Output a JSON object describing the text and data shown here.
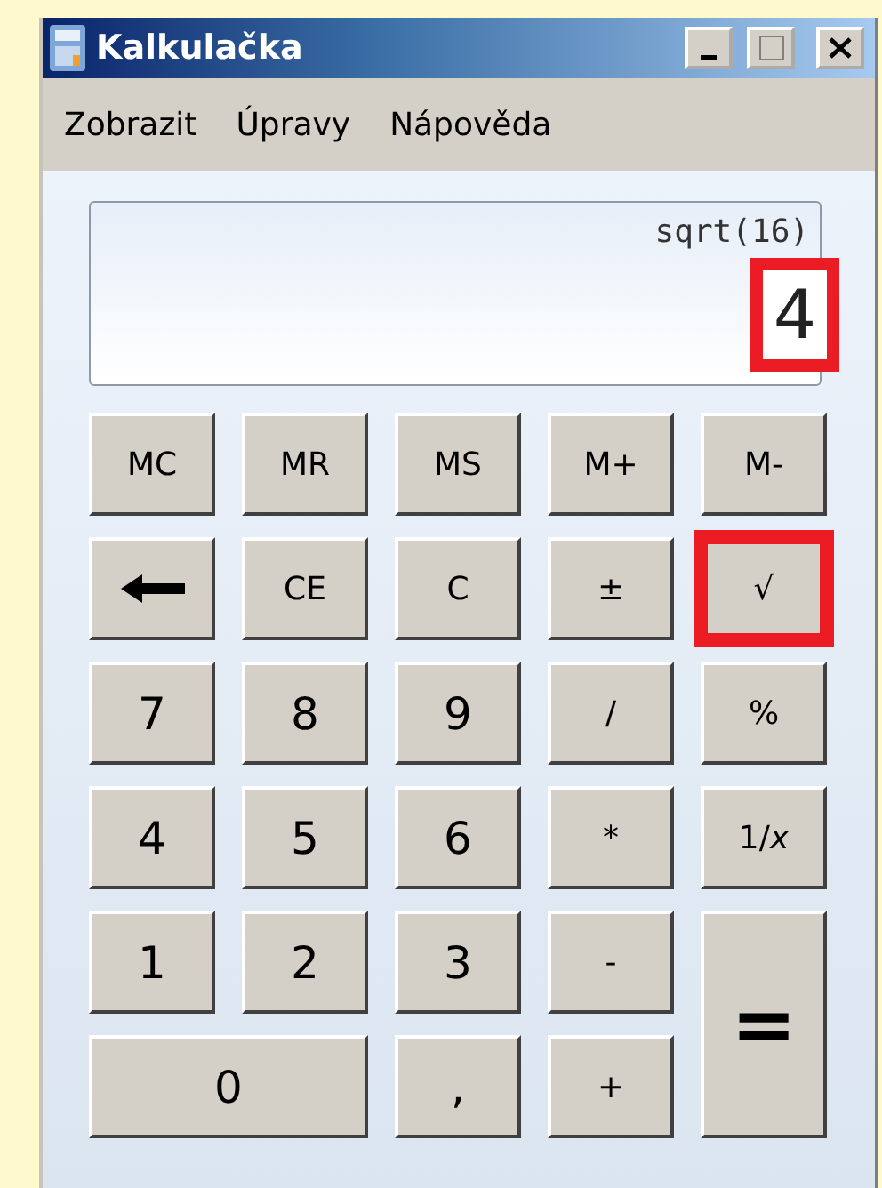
{
  "window": {
    "title": "Kalkulačka"
  },
  "menu": [
    "Zobrazit",
    "Úpravy",
    "Nápověda"
  ],
  "display": {
    "expression": "sqrt(16)",
    "result": "4",
    "highlighted": true
  },
  "buttons": [
    {
      "kind": "text",
      "label": "MC",
      "wide": false,
      "tall": false,
      "highlighted": false
    },
    {
      "kind": "text",
      "label": "MR",
      "wide": false,
      "tall": false,
      "highlighted": false
    },
    {
      "kind": "text",
      "label": "MS",
      "wide": false,
      "tall": false,
      "highlighted": false
    },
    {
      "kind": "text",
      "label": "M+",
      "wide": false,
      "tall": false,
      "highlighted": false
    },
    {
      "kind": "text",
      "label": "M-",
      "wide": false,
      "tall": false,
      "highlighted": false
    },
    {
      "kind": "backspace",
      "wide": false,
      "tall": false,
      "highlighted": false
    },
    {
      "kind": "text",
      "label": "CE",
      "wide": false,
      "tall": false,
      "highlighted": false
    },
    {
      "kind": "text",
      "label": "C",
      "wide": false,
      "tall": false,
      "highlighted": false
    },
    {
      "kind": "text",
      "label": "±",
      "wide": false,
      "tall": false,
      "highlighted": false
    },
    {
      "kind": "text",
      "label": "√",
      "wide": false,
      "tall": false,
      "highlighted": true
    },
    {
      "kind": "digit",
      "label": "7",
      "wide": false,
      "tall": false,
      "highlighted": false
    },
    {
      "kind": "digit",
      "label": "8",
      "wide": false,
      "tall": false,
      "highlighted": false
    },
    {
      "kind": "digit",
      "label": "9",
      "wide": false,
      "tall": false,
      "highlighted": false
    },
    {
      "kind": "text",
      "label": "/",
      "wide": false,
      "tall": false,
      "highlighted": false
    },
    {
      "kind": "text",
      "label": "%",
      "wide": false,
      "tall": false,
      "highlighted": false
    },
    {
      "kind": "digit",
      "label": "4",
      "wide": false,
      "tall": false,
      "highlighted": false
    },
    {
      "kind": "digit",
      "label": "5",
      "wide": false,
      "tall": false,
      "highlighted": false
    },
    {
      "kind": "digit",
      "label": "6",
      "wide": false,
      "tall": false,
      "highlighted": false
    },
    {
      "kind": "text",
      "label": "*",
      "wide": false,
      "tall": false,
      "highlighted": false
    },
    {
      "kind": "text",
      "label": "1/*x*",
      "wide": false,
      "tall": false,
      "highlighted": false
    },
    {
      "kind": "digit",
      "label": "1",
      "wide": false,
      "tall": false,
      "highlighted": false
    },
    {
      "kind": "digit",
      "label": "2",
      "wide": false,
      "tall": false,
      "highlighted": false
    },
    {
      "kind": "digit",
      "label": "3",
      "wide": false,
      "tall": false,
      "highlighted": false
    },
    {
      "kind": "text",
      "label": "-",
      "wide": false,
      "tall": false,
      "highlighted": false
    },
    {
      "kind": "equals",
      "label": "=",
      "wide": false,
      "tall": true,
      "highlighted": false
    },
    {
      "kind": "digit",
      "label": "0",
      "wide": true,
      "tall": false,
      "highlighted": false
    },
    {
      "kind": "digit",
      "label": ",",
      "wide": false,
      "tall": false,
      "highlighted": false
    },
    {
      "kind": "text",
      "label": "+",
      "wide": false,
      "tall": false,
      "highlighted": false
    }
  ]
}
